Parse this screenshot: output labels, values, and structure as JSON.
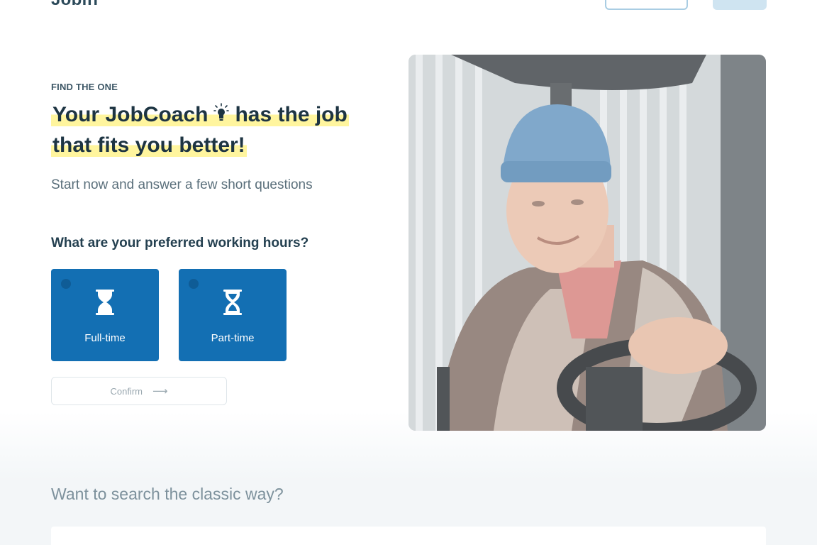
{
  "header": {
    "logo": "Jobiff",
    "outline_button_label": "",
    "filled_button_label": ""
  },
  "hero": {
    "eyebrow": "FIND THE ONE",
    "headline_part1": "Your JobCoach",
    "headline_part2": "has the job",
    "headline_part3": "that fits you better!",
    "subtitle": "Start now and answer a few short questions"
  },
  "question": {
    "text": "What are your preferred working hours?",
    "options": [
      {
        "label": "Full-time",
        "icon": "hourglass-full-icon"
      },
      {
        "label": "Part-time",
        "icon": "hourglass-half-icon"
      }
    ],
    "confirm_label": "Confirm"
  },
  "photo": {
    "subject": "worker-in-blue-beanie-driving-forklift"
  },
  "classic": {
    "title": "Want to search the classic way?"
  },
  "colors": {
    "primary": "#136fb3",
    "highlight": "#fff59e",
    "text_dark": "#1d3442"
  }
}
